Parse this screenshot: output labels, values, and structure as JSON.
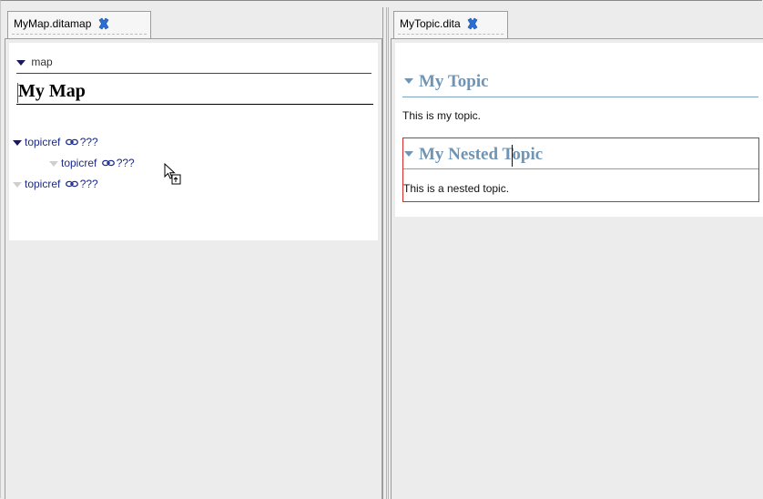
{
  "left_pane": {
    "tab_label": "MyMap.ditamap",
    "map_element": "map",
    "map_title": "My Map",
    "topicrefs": [
      {
        "label": "topicref",
        "target": "???",
        "indent": 0,
        "expanded": true
      },
      {
        "label": "topicref",
        "target": "???",
        "indent": 1,
        "expanded": false
      },
      {
        "label": "topicref",
        "target": "???",
        "indent": 0,
        "expanded": false
      }
    ]
  },
  "right_pane": {
    "tab_label": "MyTopic.dita",
    "topic_title": "My Topic",
    "topic_body": "This is my topic.",
    "nested_title": "My Nested Topic",
    "nested_body": "This is a nested topic."
  },
  "icons": {
    "tab_close": "close-x-icon",
    "link": "chain-link-icon",
    "cursor": "drag-hand-cursor-icon"
  },
  "colors": {
    "accent_heading": "#6f94b4",
    "selection_border": "#d52b2b",
    "link_text": "#1c2a8a",
    "close_icon": "#2a6fd6"
  }
}
